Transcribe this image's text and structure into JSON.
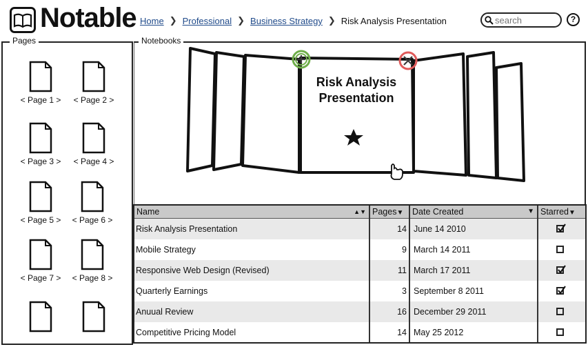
{
  "app": {
    "logo_text": "Notable"
  },
  "breadcrumb": {
    "items": [
      "Home",
      "Professional",
      "Business Strategy"
    ],
    "current": "Risk Analysis Presentation"
  },
  "search": {
    "placeholder": "search"
  },
  "help": {
    "label": "?"
  },
  "pages_panel": {
    "title": "Pages",
    "pages": [
      "< Page 1 >",
      "< Page 2 >",
      "< Page 3 >",
      "< Page 4 >",
      "< Page 5 >",
      "< Page 6 >",
      "< Page 7 >",
      "< Page 8 >",
      "",
      ""
    ]
  },
  "notebooks_panel": {
    "title": "Notebooks",
    "featured_title": "Risk Analysis Presentation",
    "colors": {
      "add": "#6fae4a",
      "remove": "#e05a5a"
    }
  },
  "table": {
    "columns": [
      "Name",
      "Pages",
      "Date Created",
      "Starred"
    ],
    "rows": [
      {
        "name": "Risk Analysis Presentation",
        "pages": "14",
        "date": "June 14 2010",
        "starred": true
      },
      {
        "name": "Mobile Strategy",
        "pages": "9",
        "date": "March 14 2011",
        "starred": false
      },
      {
        "name": "Responsive Web Design (Revised)",
        "pages": "11",
        "date": "March 17 2011",
        "starred": true
      },
      {
        "name": "Quarterly Earnings",
        "pages": "3",
        "date": "September 8 2011",
        "starred": true
      },
      {
        "name": "Anuual Review",
        "pages": "16",
        "date": "December 29 2011",
        "starred": false
      },
      {
        "name": "Competitive Pricing Model",
        "pages": "14",
        "date": "May 25 2012",
        "starred": false
      }
    ]
  }
}
